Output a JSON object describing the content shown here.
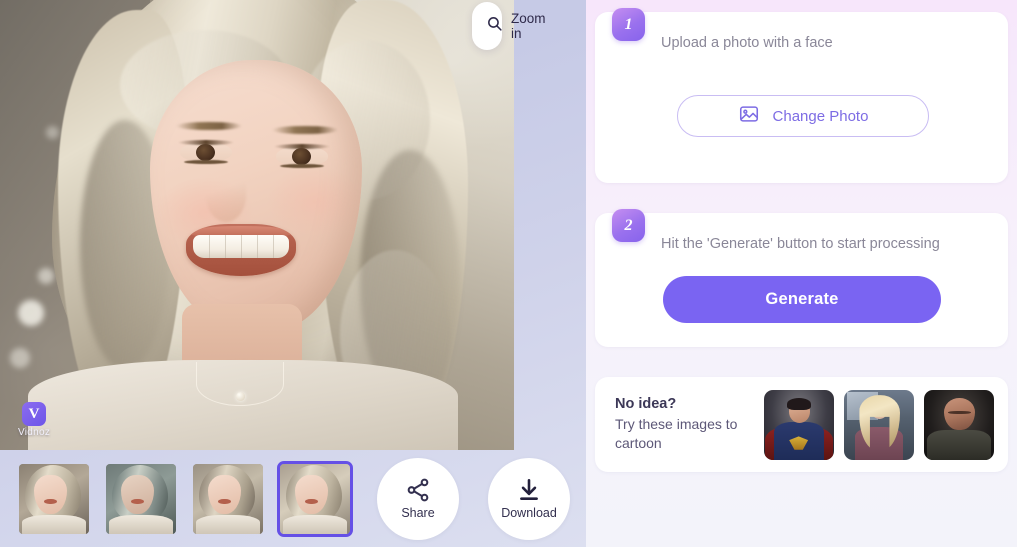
{
  "left": {
    "zoom_pill": {
      "label": "Zoom in",
      "icon": "search-icon"
    },
    "watermark": {
      "mark": "V",
      "text": "Vidnoz"
    },
    "thumbnails": [
      {
        "id": "result-1",
        "selected": false
      },
      {
        "id": "result-2",
        "selected": false
      },
      {
        "id": "result-3",
        "selected": false
      },
      {
        "id": "result-4",
        "selected": true
      }
    ],
    "actions": [
      {
        "label": "Share",
        "icon": "share-icon"
      },
      {
        "label": "Download",
        "icon": "download-icon"
      }
    ]
  },
  "right": {
    "step1": {
      "badge": "1",
      "title": "Upload a photo with a face",
      "button_label": "Change Photo",
      "button_icon": "image-icon"
    },
    "step2": {
      "badge": "2",
      "title": "Hit the 'Generate' button to start processing",
      "button_label": "Generate"
    },
    "suggestion": {
      "title": "No idea?",
      "subtitle": "Try these images to cartoon",
      "samples": [
        {
          "id": "sample-superhero"
        },
        {
          "id": "sample-blonde-woman"
        },
        {
          "id": "sample-bald-man"
        }
      ]
    }
  },
  "colors": {
    "accent_purple": "#7a64f2",
    "badge_gradient_start": "#c58ef0",
    "badge_gradient_end": "#8763ec",
    "selected_border": "#6550e6",
    "panel_bg_left": "#c9cde8",
    "panel_bg_right": "#f7e6fb"
  }
}
